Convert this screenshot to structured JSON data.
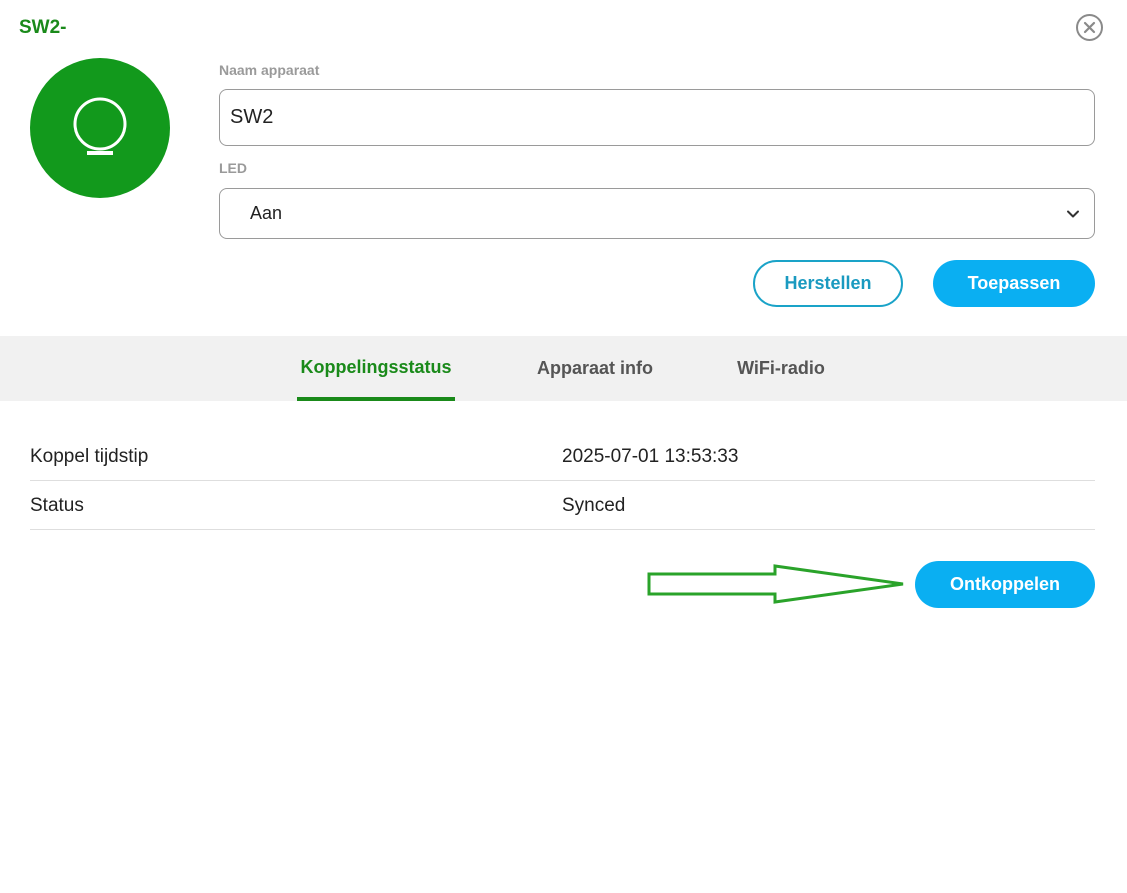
{
  "dialog": {
    "title": "SW2-"
  },
  "device": {
    "icon": "ring-lamp-icon",
    "icon_color": "#ffffff",
    "avatar_color": "#12991c"
  },
  "form": {
    "name_label": "Naam apparaat",
    "name_value": "SW2",
    "led_label": "LED",
    "led_selected": "Aan"
  },
  "actions": {
    "reset_label": "Herstellen",
    "apply_label": "Toepassen"
  },
  "tabs": [
    {
      "label": "Koppelingsstatus",
      "active": true
    },
    {
      "label": "Apparaat info",
      "active": false
    },
    {
      "label": "WiFi-radio",
      "active": false
    }
  ],
  "pairing": {
    "rows": [
      {
        "key": "Koppel tijdstip",
        "value": "2025-07-01 13:53:33"
      },
      {
        "key": "Status",
        "value": "Synced"
      }
    ],
    "unpair_label": "Ontkoppelen"
  },
  "colors": {
    "accent_green": "#1a8a1a",
    "primary_blue": "#0aaff2",
    "annotation_arrow": "#2aa32a"
  }
}
